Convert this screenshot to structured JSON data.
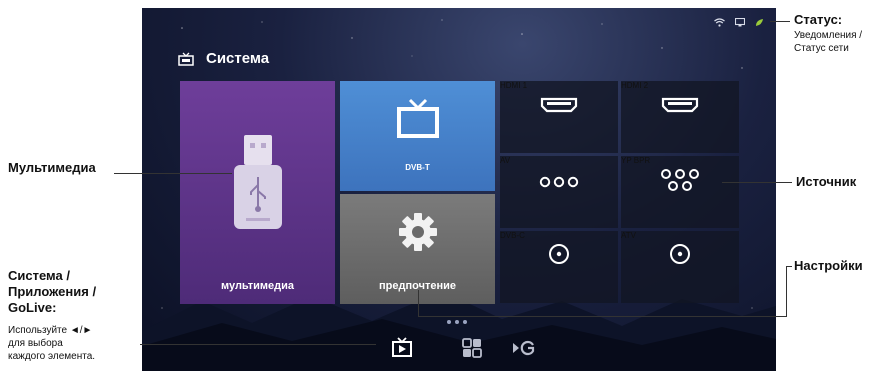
{
  "screen": {
    "section_title": "Система",
    "tiles": {
      "multimedia": "мультимедиа",
      "dvbt": "DVB-T",
      "preferences": "предпочтение"
    },
    "sources": [
      {
        "id": "hdmi1",
        "label": "HDMI 1",
        "icon": "hdmi-port-icon"
      },
      {
        "id": "hdmi2",
        "label": "HDMI 2",
        "icon": "hdmi-port-icon"
      },
      {
        "id": "av",
        "label": "AV",
        "icon": "av-jacks-icon"
      },
      {
        "id": "ypbpr",
        "label": "YP BPR",
        "icon": "component-jacks-icon"
      },
      {
        "id": "dvbc",
        "label": "DVB-C",
        "icon": "coax-connector-icon"
      },
      {
        "id": "atv",
        "label": "ATV",
        "icon": "coax-connector-icon"
      }
    ],
    "status_icons": [
      "wifi-icon",
      "network-monitor-icon",
      "notification-leaf-icon"
    ],
    "bottom_nav": [
      "tv-system-icon",
      "apps-grid-icon",
      "golive-icon"
    ],
    "colors": {
      "multimedia_tile": "#6e3e9a",
      "dvbt_tile": "#4f8fd6",
      "preferences_tile": "#707070",
      "source_tile": "#121624"
    }
  },
  "annotations": {
    "status_title": "Статус:",
    "status_desc_1": "Уведомления /",
    "status_desc_2": "Статус сети",
    "multimedia": "Мультимедиа",
    "source": "Источник",
    "settings": "Настройки",
    "system_title_1": "Система /",
    "system_title_2": "Приложения /",
    "system_title_3": "GoLive:",
    "system_desc_1": "Используйте ◄/►",
    "system_desc_2": "для выбора",
    "system_desc_3": "каждого элемента."
  }
}
